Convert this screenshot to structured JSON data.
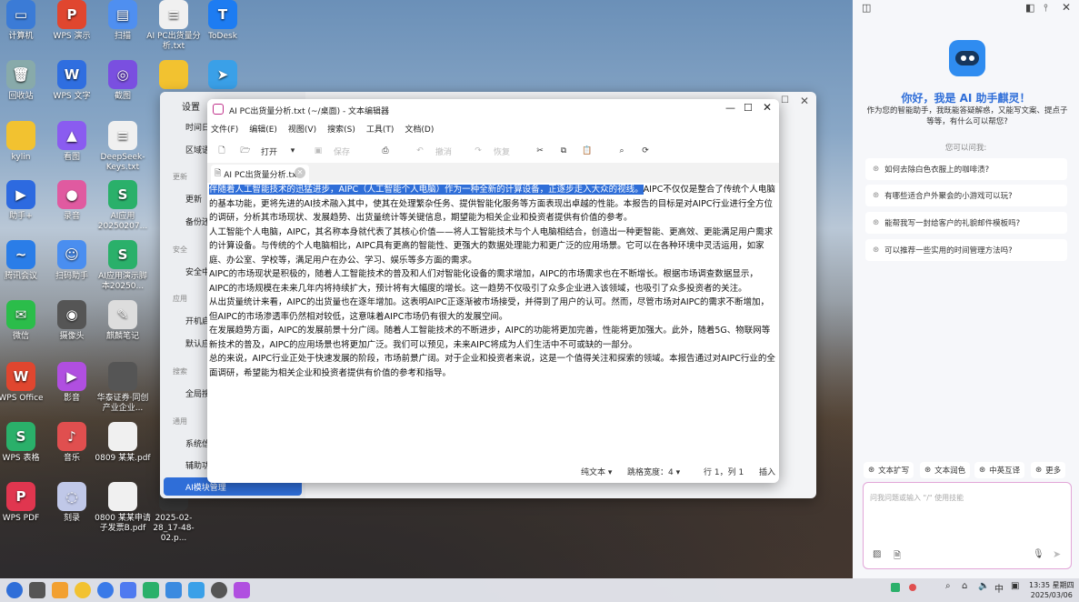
{
  "desktop": {
    "icons": [
      {
        "label": "计算机",
        "glyph": "▭",
        "color": "#3b7bd6"
      },
      {
        "label": "WPS 演示",
        "glyph": "P",
        "color": "#e0462f"
      },
      {
        "label": "扫描",
        "glyph": "▤",
        "color": "#4f8ff0"
      },
      {
        "label": "AI PC出货量分析.txt",
        "glyph": "≡",
        "color": "#f0f0f0"
      },
      {
        "label": "ToDesk",
        "glyph": "T",
        "color": "#1d7cf2"
      },
      {
        "label": "回收站",
        "glyph": "🗑",
        "color": "#8aa"
      },
      {
        "label": "WPS 文字",
        "glyph": "W",
        "color": "#2f6ee0"
      },
      {
        "label": "截图",
        "glyph": "◎",
        "color": "#7a4fe0"
      },
      {
        "label": "",
        "glyph": "",
        "color": "#f2c230"
      },
      {
        "label": "",
        "glyph": "➤",
        "color": "#3aa0e8"
      },
      {
        "label": "kylin",
        "glyph": "",
        "color": "#f2c230"
      },
      {
        "label": "看图",
        "glyph": "▲",
        "color": "#8a5cf0"
      },
      {
        "label": "DeepSeek-Keys.txt",
        "glyph": "≡",
        "color": "#f0f0f0"
      },
      {
        "label": "助手+",
        "glyph": "▶",
        "color": "#2d6ae0"
      },
      {
        "label": "录音",
        "glyph": "●",
        "color": "#e05aa0"
      },
      {
        "label": "AI应用 20250207...",
        "glyph": "S",
        "color": "#2ab06a"
      },
      {
        "label": "腾讯会议",
        "glyph": "~",
        "color": "#2a7de8"
      },
      {
        "label": "扫码助手",
        "glyph": "☺",
        "color": "#4a8ef0"
      },
      {
        "label": "AI应用演示脚本20250...",
        "glyph": "S",
        "color": "#2ab06a"
      },
      {
        "label": "微信",
        "glyph": "✉",
        "color": "#2bbd4a"
      },
      {
        "label": "摄像头",
        "glyph": "◉",
        "color": "#555"
      },
      {
        "label": "麒麟笔记",
        "glyph": "✎",
        "color": "#ddd"
      },
      {
        "label": "WPS Office",
        "glyph": "W",
        "color": "#e0462f"
      },
      {
        "label": "影音",
        "glyph": "▶",
        "color": "#b04fe0"
      },
      {
        "label": "华泰证券·同创产业企业...",
        "glyph": "",
        "color": "#555"
      },
      {
        "label": "WPS 表格",
        "glyph": "S",
        "color": "#2ab06a"
      },
      {
        "label": "音乐",
        "glyph": "♪",
        "color": "#e04f4f"
      },
      {
        "label": "0809 某某.pdf",
        "glyph": "",
        "color": "#f0f0f0"
      },
      {
        "label": "WPS PDF",
        "glyph": "P",
        "color": "#e0364f"
      },
      {
        "label": "刻录",
        "glyph": "◌",
        "color": "#c0c8e8"
      },
      {
        "label": "0800 某某申请 子发票B.pdf",
        "glyph": "",
        "color": "#f0f0f0"
      },
      {
        "label": "2025-02-28_17-48-02.p...",
        "glyph": "",
        "color": "#333"
      }
    ]
  },
  "settings": {
    "title": "设置",
    "items": [
      "时间日期",
      "区域语言",
      "更新",
      "备份还原",
      "安全中心",
      "开机启动",
      "默认应用",
      "全局搜索",
      "系统信息",
      "辅助功能",
      "AI模块管理"
    ],
    "heads": [
      "更新",
      "安全",
      "应用",
      "搜索",
      "通用"
    ]
  },
  "editor": {
    "title": "AI PC出货量分析.txt (~/桌面) - 文本编辑器",
    "menu": [
      "文件(F)",
      "编辑(E)",
      "视图(V)",
      "搜索(S)",
      "工具(T)",
      "文档(D)"
    ],
    "open_label": "打开",
    "save_label": "保存",
    "undo_label": "撤消",
    "redo_label": "恢复",
    "tab": "AI PC出货量分析.txt",
    "highlight": "伴随着人工智能技术的迅猛进步，AIPC（人工智能个人电脑）作为一种全新的计算设备，正逐步走入大众的视线。",
    "para1_rest": "AIPC不仅仅是整合了传统个人电脑的基本功能，更将先进的AI技术融入其中，使其在处理繁杂任务、提供智能化服务等方面表现出卓越的性能。本报告的目标是对AIPC行业进行全方位的调研，分析其市场现状、发展趋势、出货量统计等关键信息，期望能为相关企业和投资者提供有价值的参考。",
    "paras": [
      "人工智能个人电脑，AIPC，其名称本身就代表了其核心价值——将人工智能技术与个人电脑相结合，创造出一种更智能、更高效、更能满足用户需求的计算设备。与传统的个人电脑相比，AIPC具有更高的智能性、更强大的数据处理能力和更广泛的应用场景。它可以在各种环境中灵活运用，如家庭、办公室、学校等，满足用户在办公、学习、娱乐等多方面的需求。",
      "AIPC的市场现状是积极的，随着人工智能技术的普及和人们对智能化设备的需求增加，AIPC的市场需求也在不断增长。根据市场调查数据显示，AIPC的市场规模在未来几年内将持续扩大，预计将有大幅度的增长。这一趋势不仅吸引了众多企业进入该领域，也吸引了众多投资者的关注。",
      "从出货量统计来看，AIPC的出货量也在逐年增加。这表明AIPC正逐渐被市场接受，并得到了用户的认可。然而，尽管市场对AIPC的需求不断增加，但AIPC的市场渗透率仍然相对较低，这意味着AIPC市场仍有很大的发展空间。",
      "在发展趋势方面，AIPC的发展前景十分广阔。随着人工智能技术的不断进步，AIPC的功能将更加完善，性能将更加强大。此外，随着5G、物联网等新技术的普及，AIPC的应用场景也将更加广泛。我们可以预见，未来AIPC将成为人们生活中不可或缺的一部分。",
      "总的来说，AIPC行业正处于快速发展的阶段，市场前景广阔。对于企业和投资者来说，这是一个值得关注和探索的领域。本报告通过对AIPC行业的全面调研，希望能为相关企业和投资者提供有价值的参考和指导。"
    ],
    "status": {
      "format": "纯文本",
      "tab_width": "跳格宽度：4",
      "position": "行 1，列 1",
      "mode": "插入"
    }
  },
  "ai": {
    "greeting": "你好，我是 AI 助手麒灵！",
    "intro": "作为您的智能助手，我既能答疑解惑，又能写文案、提点子等等，有什么可以帮您?",
    "ask_label": "您可以问我:",
    "suggestions": [
      "如何去除白色衣服上的咖啡渍?",
      "有哪些适合户外聚会的小游戏可以玩?",
      "能帮我写一封给客户的礼貌邮件模板吗?",
      "可以推荐一些实用的时间管理方法吗?"
    ],
    "chips": [
      "文本扩写",
      "文本润色",
      "中英互译",
      "更多"
    ],
    "input_placeholder": "问我问题或输入 \"/\" 使用技能"
  },
  "taskbar": {
    "time": "13:35 星期四",
    "date": "2025/03/06"
  }
}
